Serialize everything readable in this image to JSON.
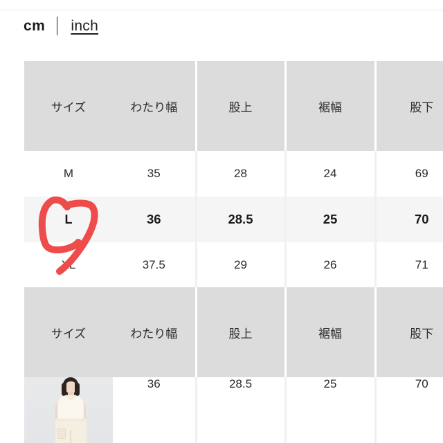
{
  "unit_toggle": {
    "active_label": "cm",
    "inactive_label": "inch"
  },
  "tables": [
    {
      "id": "primary",
      "headers": [
        "サイズ",
        "わたり幅",
        "股上",
        "裾幅",
        "股下"
      ],
      "rows": [
        {
          "size": "M",
          "values": [
            "35",
            "28",
            "24",
            "69"
          ],
          "highlighted": false
        },
        {
          "size": "L",
          "values": [
            "36",
            "28.5",
            "25",
            "70"
          ],
          "highlighted": true
        },
        {
          "size": "XL",
          "values": [
            "37.5",
            "29",
            "26",
            "71"
          ],
          "highlighted": false
        }
      ]
    },
    {
      "id": "secondary",
      "headers": [
        "サイズ",
        "わたり幅",
        "股上",
        "裾幅",
        "股下"
      ],
      "rows": [
        {
          "size": "",
          "values": [
            "36",
            "28.5",
            "25",
            "70"
          ],
          "highlighted": false,
          "has_photo": true
        }
      ]
    }
  ],
  "annotation": {
    "kind": "handwritten-circle",
    "target_label": "L",
    "color": "#ee4b4b"
  },
  "photo": {
    "alt": "model-wearing-cream-top-and-cargo-pants"
  }
}
